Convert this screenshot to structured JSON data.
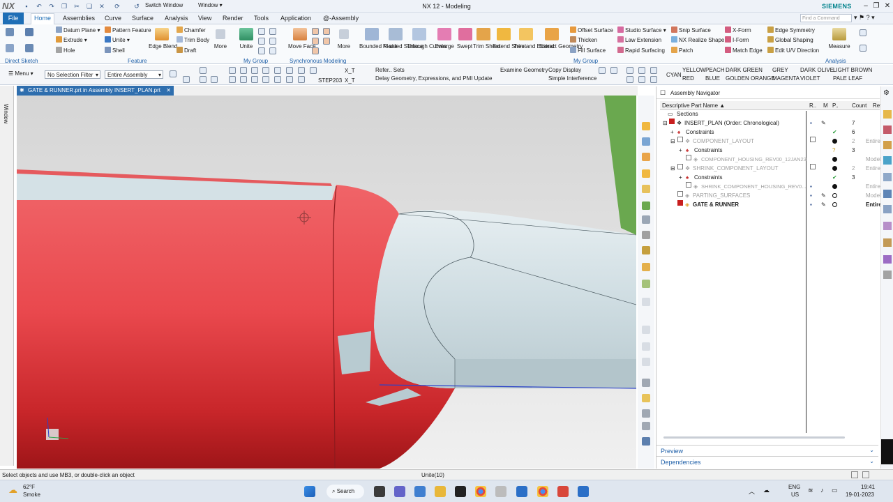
{
  "title_bar": {
    "logo": "NX",
    "switch_window": "Switch Window",
    "window": "Window",
    "app_title": "NX 12 - Modeling",
    "brand": "SIEMENS"
  },
  "menu_tabs": [
    "File",
    "Home",
    "Assemblies",
    "Curve",
    "Surface",
    "Analysis",
    "View",
    "Render",
    "Tools",
    "Application",
    "@-Assembly"
  ],
  "command_finder_placeholder": "Find a Command",
  "ribbon": {
    "direct_sketch": "Direct Sketch",
    "feature_items": [
      "Datum Plane",
      "Extrude",
      "Hole",
      "Pattern Feature",
      "Unite",
      "Shell",
      "Chamfer",
      "Trim Body",
      "Draft"
    ],
    "edge_blend": "Edge Blend",
    "more": "More",
    "feature_group": "Feature",
    "unite": "Unite",
    "my_group": "My Group",
    "move_face": "Move Face",
    "sync_group": "Synchronous Modeling",
    "surface_tools": [
      "Bounded Plane",
      "N-sided Surface",
      "Through Curves",
      "Enlarge",
      "Swept",
      "Trim Sheet",
      "Extend Sheet",
      "Trim and Extend",
      "Extract Geometry"
    ],
    "surface_list_1": [
      "Offset Surface",
      "Thicken",
      "Fill Surface"
    ],
    "surface_list_2": [
      "Studio Surface",
      "Law Extension",
      "Rapid Surfacing"
    ],
    "surface_list_3": [
      "Snip Surface",
      "NX Realize Shape",
      "Patch"
    ],
    "surface_list_4": [
      "X-Form",
      "I-Form",
      "Match Edge"
    ],
    "surface_list_5": [
      "Edge Symmetry",
      "Global Shaping",
      "Edit U/V Direction"
    ],
    "my_group_2": "My Group",
    "measure": "Measure",
    "analysis_group": "Analysis"
  },
  "toolbar2": {
    "menu": "Menu",
    "selection_filter": "No Selection Filter",
    "scope": "Entire Assembly",
    "xt1": "X_T",
    "step": "STEP203",
    "xt2": "X_T",
    "refer_sets": "Refer.. Sets",
    "delay": "Delay Geometry, Expressions, and PMI Update",
    "examine": "Examine Geometry",
    "copy_display": "Copy Display",
    "simple_interference": "Simple Interference",
    "colors_row1": [
      "CYAN",
      "YELLOW",
      "PEACH",
      "DARK GREEN",
      "GREY",
      "DARK OLIVE",
      "LIGHT BROWN"
    ],
    "colors_row2": [
      "RED",
      "BLUE",
      "GOLDEN ORANGE",
      "MAGENTA",
      "VIOLET",
      "PALE LEAF"
    ]
  },
  "document_tab": "GATE & RUNNER.prt in Assembly INSERT_PLAN.prt",
  "left_tab": "Window",
  "navigator": {
    "title": "Assembly Navigator",
    "columns": [
      "Descriptive Part Name",
      "R..",
      "M",
      "P..",
      "Count",
      "Refer"
    ],
    "rows": [
      {
        "name": "Sections",
        "count": ""
      },
      {
        "name": "INSERT_PLAN (Order: Chronological)",
        "count": "7"
      },
      {
        "name": "Constraints",
        "count": "6"
      },
      {
        "name": "COMPONENT_LAYOUT",
        "count": "2",
        "ref": "Entire"
      },
      {
        "name": "Constraints",
        "count": "3"
      },
      {
        "name": "COMPONENT_HOUSING_REV00_12JAN23",
        "count": "",
        "ref": "Model"
      },
      {
        "name": "SHRINK_COMPONENT_LAYOUT",
        "count": "2",
        "ref": "Entire"
      },
      {
        "name": "Constraints",
        "count": "3"
      },
      {
        "name": "SHRINK_COMPONENT_HOUSING_REV0...",
        "count": "",
        "ref": "Entire"
      },
      {
        "name": "PARTING_SURFACES",
        "count": "",
        "ref": "Model"
      },
      {
        "name": "GATE & RUNNER",
        "count": "",
        "ref": "Entire"
      }
    ],
    "preview": "Preview",
    "dependencies": "Dependencies"
  },
  "status": {
    "left": "Select objects and use MB3, or double-click an object",
    "center": "Unite(10)"
  },
  "taskbar": {
    "temp": "62°F",
    "weather": "Smoke",
    "search": "Search",
    "lang1": "ENG",
    "lang2": "US",
    "time": "19:41",
    "date": "19-01-2023"
  },
  "colors": {
    "accent": "#1e6eb6",
    "part_red": "#e8474c",
    "surface": "#cfdde2"
  }
}
